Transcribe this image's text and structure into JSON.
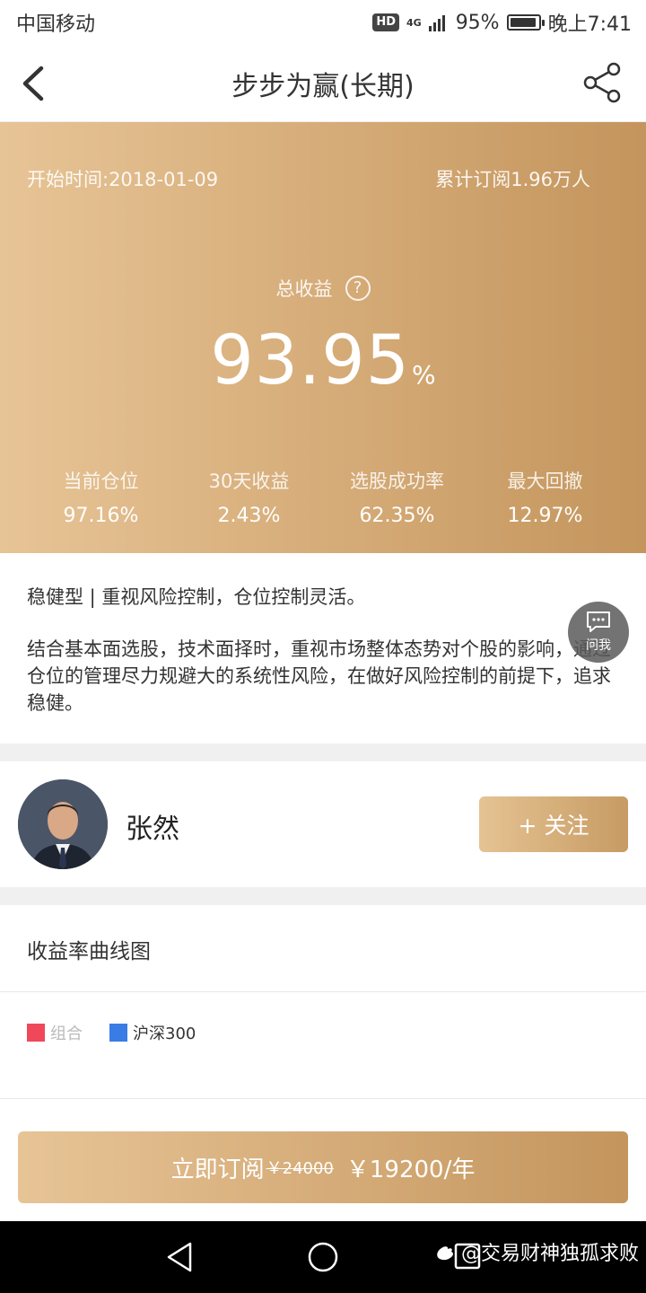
{
  "status_bar": {
    "carrier": "中国移动",
    "hd": "HD",
    "network": "4G",
    "battery_percent": "95%",
    "battery_level": 0.95,
    "time": "晚上7:41"
  },
  "nav": {
    "title": "步步为赢(长期)"
  },
  "hero": {
    "start_time": "开始时间:2018-01-09",
    "subscribers": "累计订阅1.96万人",
    "total_label": "总收益",
    "help_symbol": "?",
    "total_value": "93.95",
    "total_unit": "%",
    "stats": [
      {
        "label": "当前仓位",
        "value": "97.16%"
      },
      {
        "label": "30天收益",
        "value": "2.43%"
      },
      {
        "label": "选股成功率",
        "value": "62.35%"
      },
      {
        "label": "最大回撤",
        "value": "12.97%"
      }
    ]
  },
  "description": {
    "tagline": "稳健型 | 重视风险控制，仓位控制灵活。",
    "body": "结合基本面选股，技术面择时，重视市场整体态势对个股的影响，通过仓位的管理尽力规避大的系统性风险，在做好风险控制的前提下，追求稳健。"
  },
  "ask_button": {
    "label": "问我"
  },
  "author": {
    "name": "张然",
    "follow_label": "+ 关注"
  },
  "chart": {
    "title": "收益率曲线图",
    "legend": [
      {
        "label": "组合",
        "color": "#f0485a",
        "text_color": "#bbbbbb"
      },
      {
        "label": "沪深300",
        "color": "#3a7ce6",
        "text_color": "#333333"
      }
    ]
  },
  "subscribe": {
    "label": "立即订阅",
    "old_price": "￥24000",
    "new_price": "￥19200/年"
  },
  "watermark": {
    "text": "@交易财神独孤求败"
  }
}
